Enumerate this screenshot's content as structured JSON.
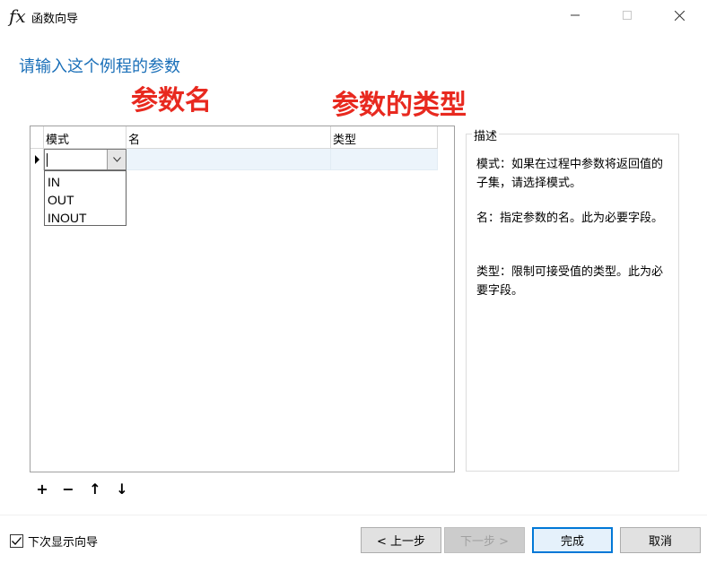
{
  "window": {
    "icon_label": "fx",
    "title": "函数向导"
  },
  "heading": "请输入这个例程的参数",
  "annotations": {
    "name_label": "参数名",
    "type_label": "参数的类型"
  },
  "grid": {
    "columns": [
      "模式",
      "名",
      "类型"
    ],
    "dropdown_options": [
      "IN",
      "OUT",
      "INOUT"
    ]
  },
  "description": {
    "legend": "描述",
    "mode_text": "模式：如果在过程中参数将返回值的子集，请选择模式。",
    "name_text": "名：指定参数的名。此为必要字段。",
    "type_text": "类型：限制可接受值的类型。此为必要字段。"
  },
  "toolbar": {
    "add": "+",
    "remove": "−",
    "up": "↑",
    "down": "↓"
  },
  "footer": {
    "show_wizard_label": "下次显示向导",
    "show_wizard_checked": true,
    "prev_label": "< 上一步",
    "next_label": "下一步 >",
    "finish_label": "完成",
    "cancel_label": "取消"
  },
  "colors": {
    "heading": "#1a6fb8",
    "annotation": "#e8291f",
    "selected_row": "#ecf4fb",
    "default_button_border": "#0078d7"
  }
}
